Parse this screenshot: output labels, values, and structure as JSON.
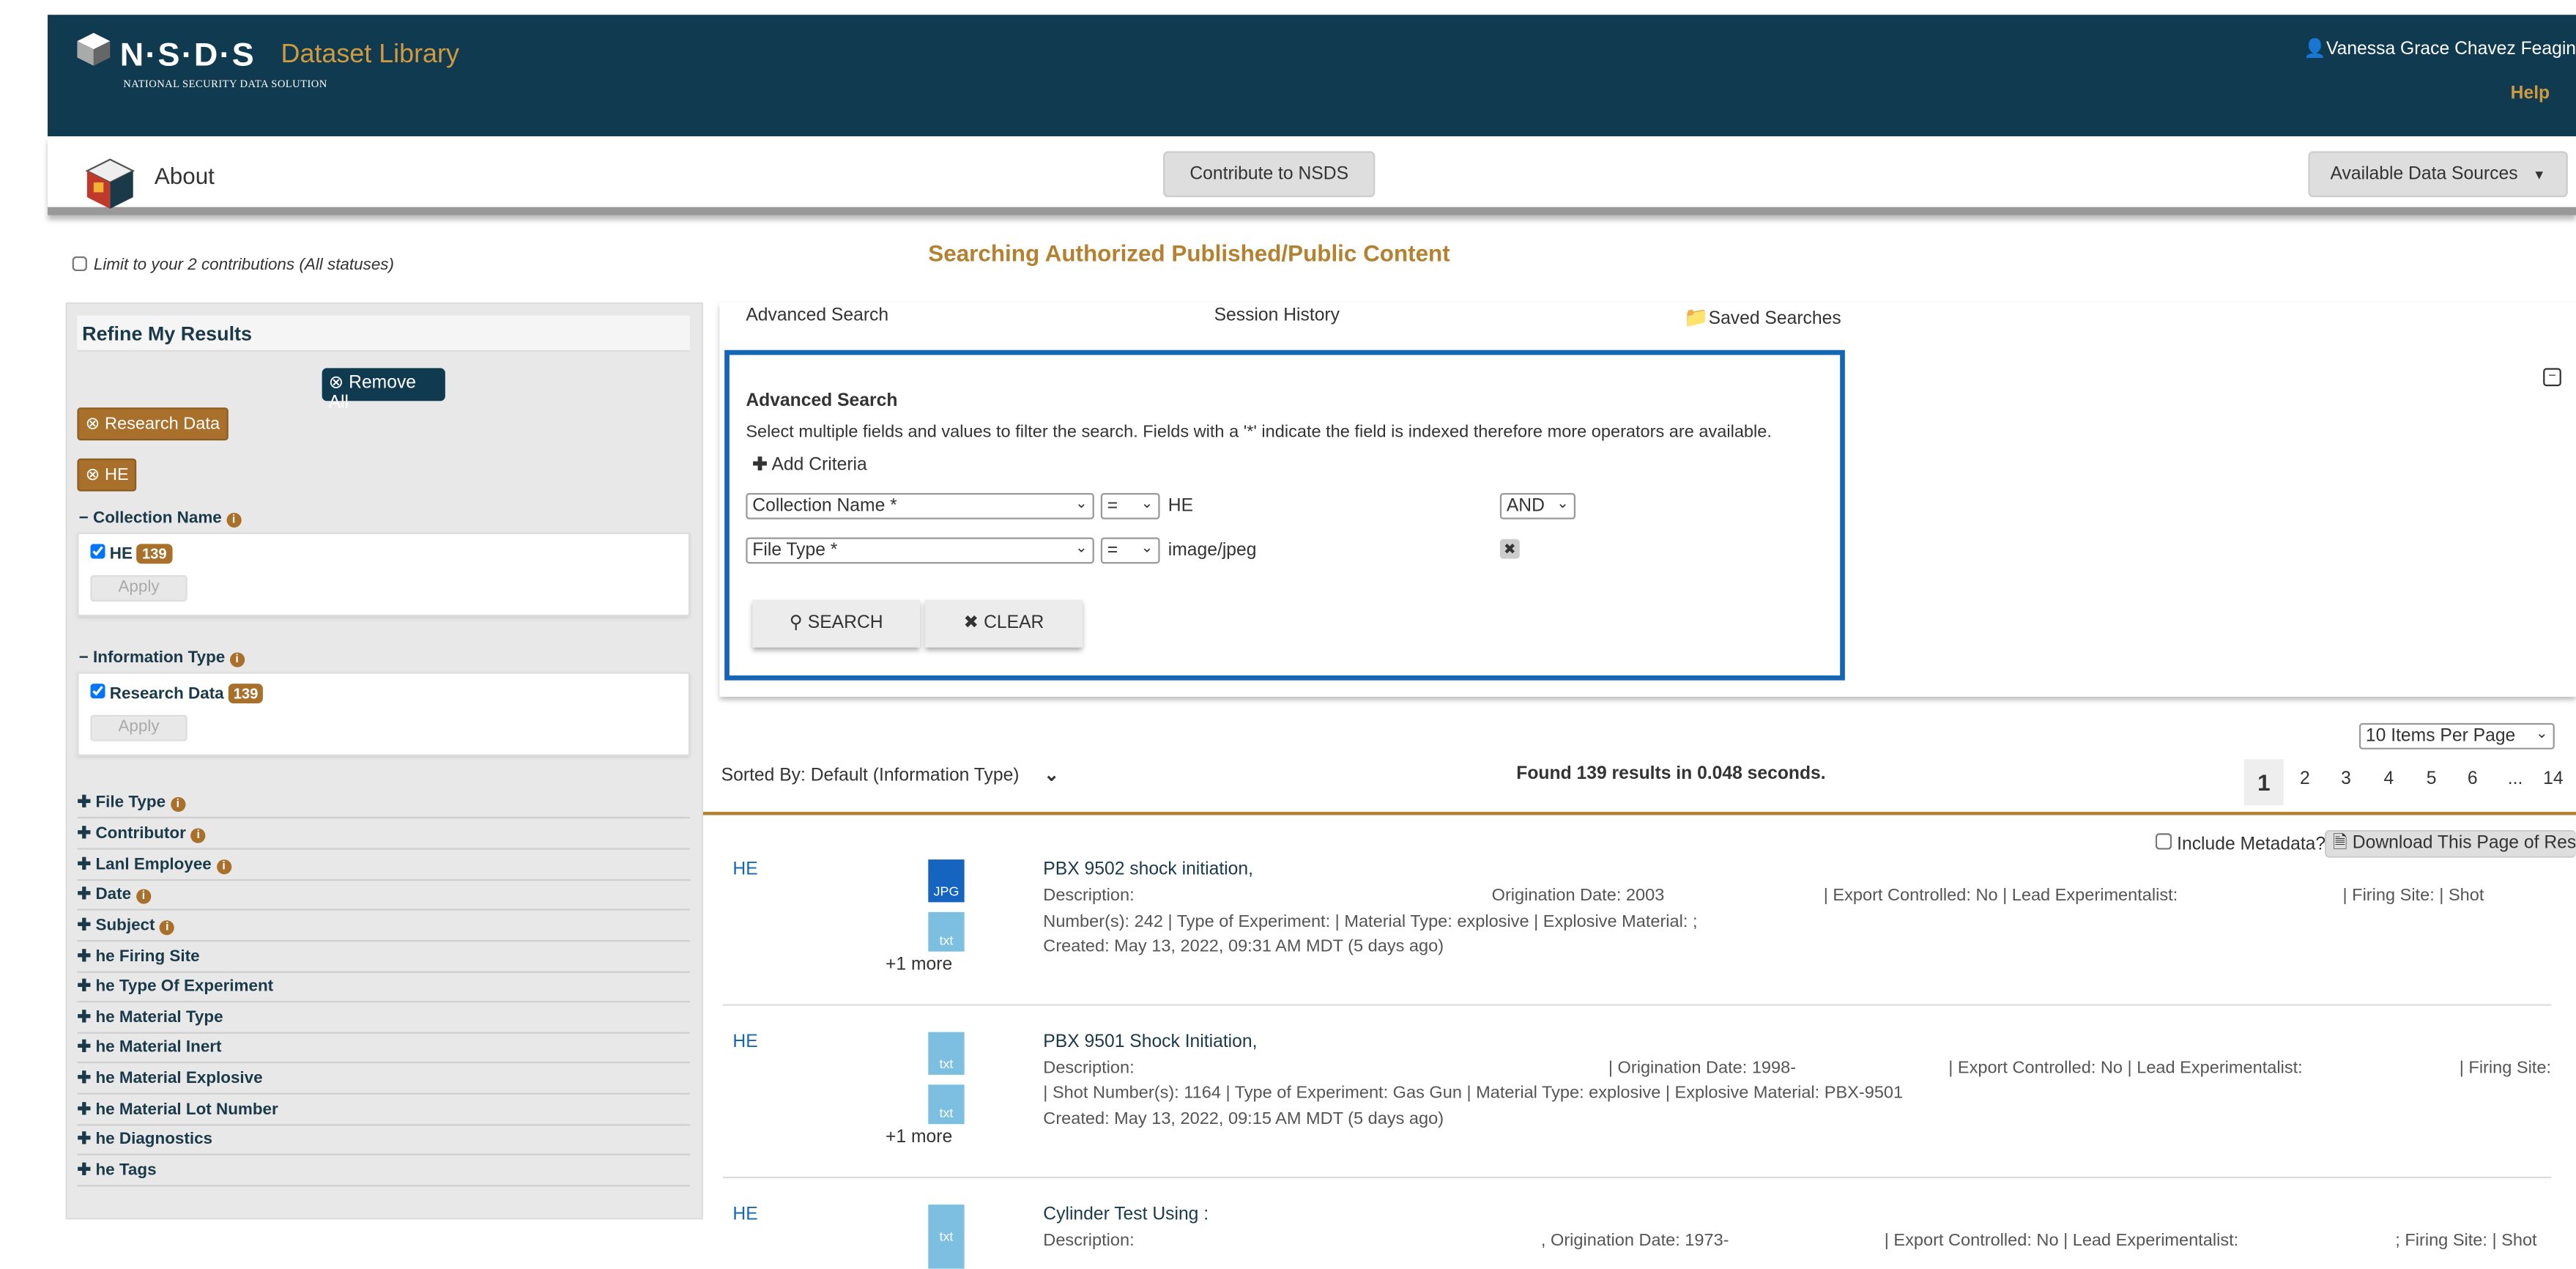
{
  "header": {
    "brand": "N·S·D·S",
    "library": "Dataset Library",
    "subtitle": "NATIONAL SECURITY DATA SOLUTION",
    "user": "Vanessa Grace Chavez Feagin",
    "help": "Help"
  },
  "nav": {
    "about": "About",
    "contribute": "Contribute to NSDS",
    "sources": "Available Data Sources"
  },
  "limit_label": "Limit to your 2 contributions (All statuses)",
  "searching": "Searching Authorized Published/Public Content",
  "sidebar": {
    "title": "Refine My Results",
    "remove_all": "Remove All",
    "tags": [
      "Research Data",
      "HE"
    ],
    "facets_open": [
      {
        "title": "Collection Name",
        "item": "HE",
        "count": "139",
        "apply": "Apply"
      },
      {
        "title": "Information Type",
        "item": "Research Data",
        "count": "139",
        "apply": "Apply"
      }
    ],
    "facets_collapsed": [
      "File Type",
      "Contributor",
      "Lanl Employee",
      "Date",
      "Subject",
      "he Firing Site",
      "he Type Of Experiment",
      "he Material Type",
      "he Material Inert",
      "he Material Explosive",
      "he Material Lot Number",
      "he Diagnostics",
      "he Tags"
    ]
  },
  "tabs": {
    "advanced": "Advanced Search",
    "history": "Session History",
    "saved": "Saved Searches"
  },
  "advanced": {
    "title": "Advanced Search",
    "description": "Select multiple fields and values to filter the search. Fields with a '*' indicate the field is indexed therefore more operators are available.",
    "add_criteria": "Add Criteria",
    "rows": [
      {
        "field": "Collection Name *",
        "op": "=",
        "value": "HE",
        "logic": "AND"
      },
      {
        "field": "File Type *",
        "op": "=",
        "value": "image/jpeg"
      }
    ],
    "search": "SEARCH",
    "clear": "CLEAR"
  },
  "results": {
    "sorted": "Sorted By: Default (Information Type)",
    "found": "Found 139 results in 0.048 seconds.",
    "per_page": "10 Items Per Page",
    "pages": [
      "1",
      "2",
      "3",
      "4",
      "5",
      "6",
      "...",
      "14"
    ],
    "include_metadata": "Include Metadata?",
    "download": "Download This Page of Res",
    "items": [
      {
        "collection": "HE",
        "icons": [
          "JPG",
          "txt"
        ],
        "more": "+1 more",
        "title": "PBX 9502 shock initiation,",
        "line1_a": "Description:",
        "line1_b": "Origination Date: 2003",
        "line1_c": "| Export Controlled: No | Lead Experimentalist:",
        "line1_d": "| Firing Site:    | Shot",
        "line2": "Number(s): 242 | Type of Experiment:              | Material Type: explosive | Explosive Material: ;",
        "created": "Created: May 13, 2022, 09:31 AM MDT (5 days ago)"
      },
      {
        "collection": "HE",
        "icons": [
          "txt",
          "txt"
        ],
        "more": "+1 more",
        "title": "PBX 9501 Shock Initiation,",
        "line1_a": "Description:",
        "line1_b": "| Origination Date: 1998-",
        "line1_c": "| Export Controlled: No | Lead Experimentalist:",
        "line1_d": "| Firing Site:",
        "line2": "| Shot Number(s): 1164 | Type of Experiment: Gas Gun | Material Type: explosive | Explosive Material: PBX-9501",
        "created": "Created: May 13, 2022, 09:15 AM MDT (5 days ago)"
      },
      {
        "collection": "HE",
        "icons": [
          "txt"
        ],
        "title": "Cylinder Test Using :",
        "line1_a": "Description:",
        "line1_b": ", Origination Date: 1973-",
        "line1_c": "| Export Controlled: No | Lead Experimentalist:",
        "line1_d": "; Firing Site:    | Shot"
      }
    ]
  },
  "colors": {
    "header": "#0f3a4f",
    "accent": "#b3812f",
    "badge": "#a8702a",
    "link": "#1565b5"
  }
}
